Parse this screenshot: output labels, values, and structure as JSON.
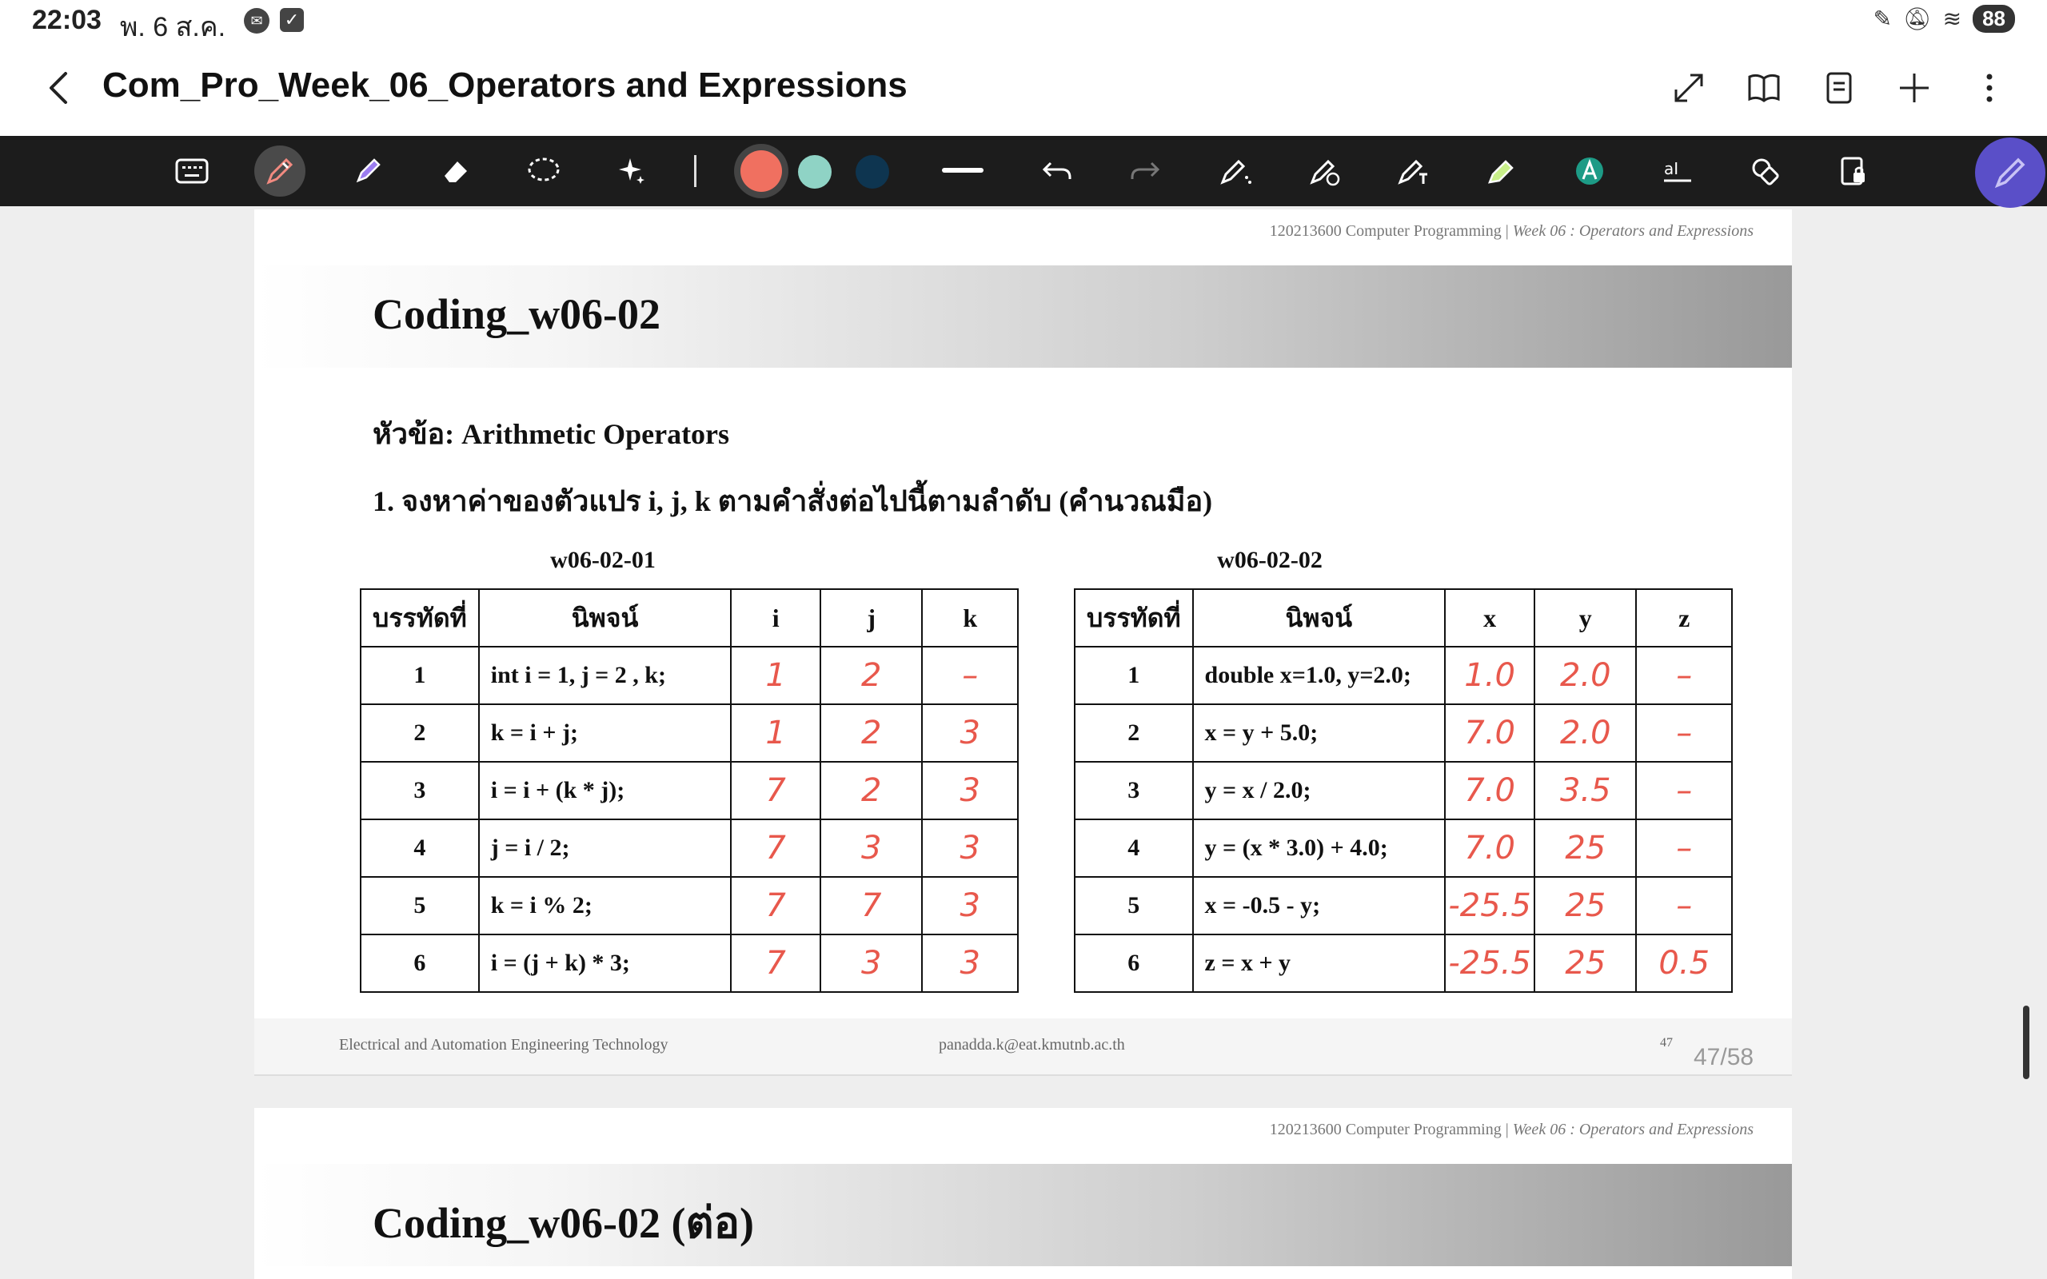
{
  "status_bar": {
    "time": "22:03",
    "date": "พ. 6 ส.ค.",
    "battery": "88"
  },
  "title_bar": {
    "title": "Com_Pro_Week_06_Operators and Expressions"
  },
  "toolbar": {
    "colors": [
      "#f07060",
      "#8fd3c5",
      "#0e3550"
    ],
    "fab_color": "#5a4fc8"
  },
  "page1": {
    "header": "120213600 Computer Programming",
    "header_sep": " | ",
    "header_italic": "Week 06 : Operators and Expressions",
    "banner_title": "Coding_w06-02",
    "topic": "หัวข้อ: Arithmetic Operators",
    "question": "1. จงหาค่าของตัวแปร i, j, k ตามคำสั่งต่อไปนี้ตามลำดับ (คำนวณมือ)",
    "table1": {
      "caption": "w06-02-01",
      "headers": [
        "บรรทัดที่",
        "นิพจน์",
        "i",
        "j",
        "k"
      ],
      "rows": [
        {
          "line": "1",
          "expr": "int i = 1, j = 2 , k;",
          "a": "1",
          "b": "2",
          "c": "–"
        },
        {
          "line": "2",
          "expr": "k = i + j;",
          "a": "1",
          "b": "2",
          "c": "3"
        },
        {
          "line": "3",
          "expr": "i = i + (k * j);",
          "a": "7",
          "b": "2",
          "c": "3"
        },
        {
          "line": "4",
          "expr": "j = i / 2;",
          "a": "7",
          "b": "3",
          "c": "3"
        },
        {
          "line": "5",
          "expr": "k = i % 2;",
          "a": "7",
          "b": "7",
          "c": "3"
        },
        {
          "line": "6",
          "expr": "i = (j + k) * 3;",
          "a": "7",
          "b": "3",
          "c": "3"
        }
      ]
    },
    "table2": {
      "caption": "w06-02-02",
      "headers": [
        "บรรทัดที่",
        "นิพจน์",
        "x",
        "y",
        "z"
      ],
      "rows": [
        {
          "line": "1",
          "expr": "double x=1.0, y=2.0;",
          "a": "1.0",
          "b": "2.0",
          "c": "–"
        },
        {
          "line": "2",
          "expr": "x = y + 5.0;",
          "a": "7.0",
          "b": "2.0",
          "c": "–"
        },
        {
          "line": "3",
          "expr": "y = x / 2.0;",
          "a": "7.0",
          "b": "3.5",
          "c": "–"
        },
        {
          "line": "4",
          "expr": "y = (x * 3.0) + 4.0;",
          "a": "7.0",
          "b": "25",
          "c": "–"
        },
        {
          "line": "5",
          "expr": "x = -0.5 - y;",
          "a": "-25.5",
          "b": "25",
          "c": "–"
        },
        {
          "line": "6",
          "expr": "z = x + y",
          "a": "-25.5",
          "b": "25",
          "c": "0.5"
        }
      ]
    },
    "footer_left": "Electrical and Automation Engineering Technology",
    "footer_center": "panadda.k@eat.kmutnb.ac.th",
    "footer_page": "47"
  },
  "page_indicator": "47/58",
  "page2": {
    "header": "120213600 Computer Programming",
    "header_sep": " | ",
    "header_italic": "Week 06 : Operators and Expressions",
    "banner_title": "Coding_w06-02 (ต่อ)"
  }
}
